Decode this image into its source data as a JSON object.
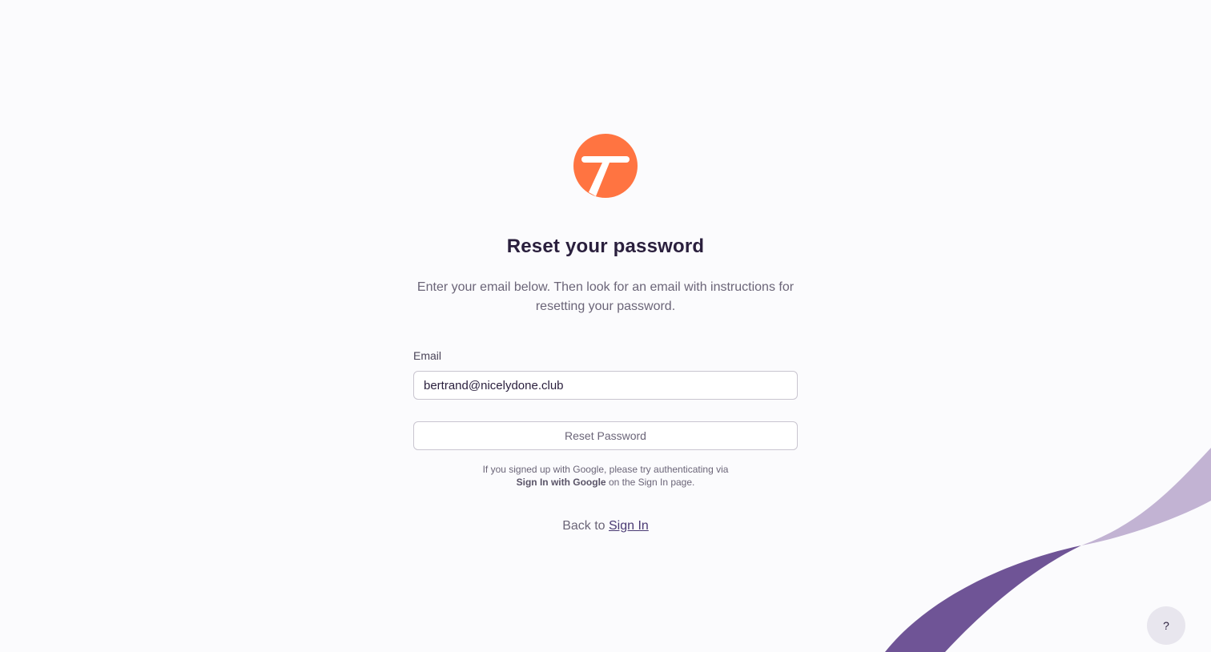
{
  "colors": {
    "background": "#fbfbfd",
    "brand_orange": "#ff7441",
    "swoosh_dark": "#6f5496",
    "swoosh_light": "#c2b3d3"
  },
  "logo": {
    "icon": "t-logo-icon"
  },
  "header": {
    "title": "Reset your password",
    "subtitle": "Enter your email below. Then look for an email with instructions for resetting your password."
  },
  "form": {
    "email_label": "Email",
    "email_value": "bertrand@nicelydone.club",
    "submit_label": "Reset Password"
  },
  "google_note": {
    "line1": "If you signed up with Google, please try authenticating via",
    "strong": "Sign In with Google",
    "line2_rest": " on the Sign In page."
  },
  "footer": {
    "back_text": "Back to ",
    "sign_in_link": "Sign In"
  },
  "help": {
    "label": "?",
    "icon": "help-icon"
  }
}
